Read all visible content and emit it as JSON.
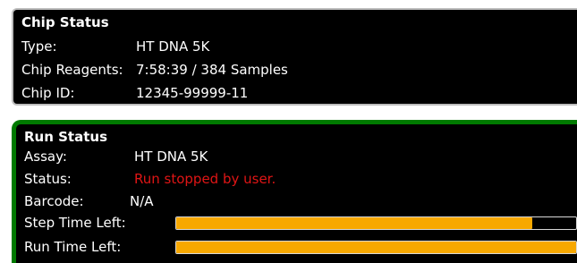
{
  "chip_status": {
    "title": "Chip Status",
    "type_label": "Type:",
    "type_value": "HT DNA 5K",
    "reagents_label": "Chip Reagents:",
    "reagents_value": "7:58:39 / 384 Samples",
    "chip_id_label": "Chip ID:",
    "chip_id_value": "12345-99999-11"
  },
  "run_status": {
    "title": "Run Status",
    "assay_label": "Assay:",
    "assay_value": "HT DNA 5K",
    "status_label": "Status:",
    "status_value": "Run stopped by user.",
    "barcode_label": "Barcode:",
    "barcode_value": "N/A",
    "step_time_label": "Step Time Left:",
    "step_time_progress": 0.89,
    "run_time_label": "Run Time Left:",
    "run_time_progress": 1.0
  },
  "colors": {
    "panel_bg": "#000000",
    "chip_border": "#bdbdbd",
    "run_border": "#007a00",
    "status_error": "#e01515",
    "progress_fill": "#f7a800"
  }
}
